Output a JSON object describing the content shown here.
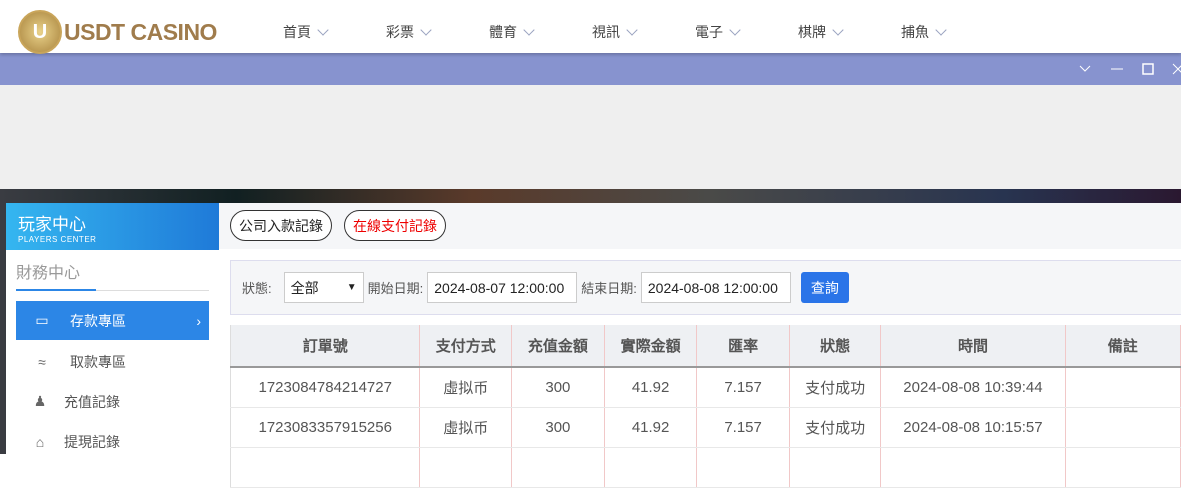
{
  "header": {
    "logo_text": "USDT CASINO",
    "logo_letter": "U",
    "nav": [
      "首頁",
      "彩票",
      "體育",
      "視訊",
      "電子",
      "棋牌",
      "捕魚"
    ]
  },
  "window": {
    "controls": [
      "chevron-down",
      "minimize",
      "maximize",
      "close"
    ]
  },
  "sidebar": {
    "title": "玩家中心",
    "subtitle": "PLAYERS CENTER",
    "section": "財務中心",
    "items": [
      {
        "label": "存款專區",
        "icon": "card-icon",
        "active": true
      },
      {
        "label": "取款專區",
        "icon": "hand-icon"
      },
      {
        "label": "充值記錄",
        "icon": "money-bag-icon"
      },
      {
        "label": "提現記錄",
        "icon": "wallet-icon"
      }
    ]
  },
  "tabs": [
    {
      "label": "公司入款記錄"
    },
    {
      "label": "在線支付記錄",
      "active": true
    }
  ],
  "filter": {
    "status_label": "狀態:",
    "status_value": "全部",
    "start_label": "開始日期:",
    "start_value": "2024-08-07 12:00:00",
    "end_label": "結束日期:",
    "end_value": "2024-08-08 12:00:00",
    "query_label": "查詢"
  },
  "table": {
    "headers": [
      "訂單號",
      "支付方式",
      "充值金額",
      "實際金額",
      "匯率",
      "狀態",
      "時間",
      "備註"
    ],
    "rows": [
      [
        "1723084784214727",
        "虛拟币",
        "300",
        "41.92",
        "7.157",
        "支付成功",
        "2024-08-08 10:39:44",
        ""
      ],
      [
        "1723083357915256",
        "虛拟币",
        "300",
        "41.92",
        "7.157",
        "支付成功",
        "2024-08-08 10:15:57",
        ""
      ]
    ]
  },
  "colors": {
    "accent": "#2c86e6",
    "titlebar": "#8793cf",
    "query_button": "#2a74e8"
  }
}
